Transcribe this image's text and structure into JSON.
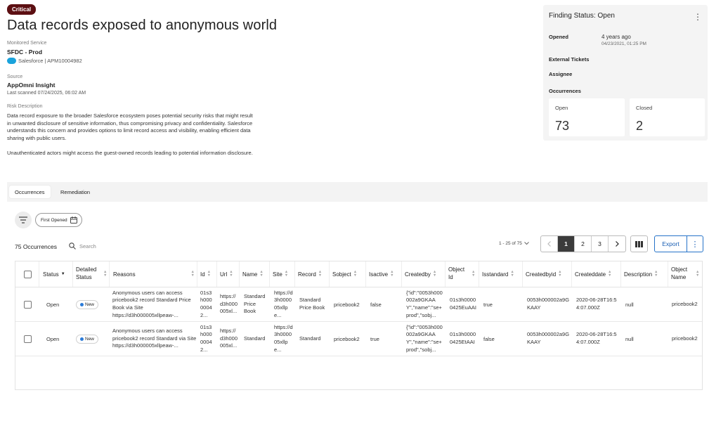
{
  "header": {
    "severity": "Critical",
    "title": "Data records exposed to anonymous world",
    "monitored_service_label": "Monitored Service",
    "monitored_service": "SFDC - Prod",
    "platform": "Salesforce | APM10004982",
    "source_label": "Source",
    "source": "AppOmni Insight",
    "last_scanned": "Last scanned 07/24/2025, 06:02 AM",
    "risk_label": "Risk Description",
    "risk_para1": "Data record exposure to the broader Salesforce ecosystem poses potential security risks that might result in unwanted disclosure of sensitive information, thus compromising privacy and confidentiality. Salesforce understands this concern and provides options to limit record access and visibility, enabling efficient data sharing with public users.",
    "risk_para2": "Unauthenticated actors might access the guest-owned records leading to potential information disclosure."
  },
  "status_panel": {
    "title": "Finding Status: Open",
    "opened_label": "Opened",
    "opened_rel": "4 years ago",
    "opened_abs": "04/23/2021, 01:25 PM",
    "external_tickets_label": "External Tickets",
    "assignee_label": "Assignee",
    "occurrences_label": "Occurrences",
    "open_label": "Open",
    "open_count": "73",
    "closed_label": "Closed",
    "closed_count": "2"
  },
  "tabs": [
    "Occurrences",
    "Remediation"
  ],
  "filters": {
    "chip_label": "First Opened"
  },
  "toolbar": {
    "count_label": "75 Occurrences",
    "search_placeholder": "Search",
    "range_label": "1 - 25 of 75",
    "pages": [
      "1",
      "2",
      "3"
    ],
    "export_label": "Export"
  },
  "table": {
    "columns": [
      "Status",
      "Detailed Status",
      "Reasons",
      "Id",
      "Url",
      "Name",
      "Site",
      "Record",
      "Sobject",
      "Isactive",
      "Createdby",
      "Object Id",
      "Isstandard",
      "Createdbyid",
      "Createddate",
      "Description",
      "Object Name"
    ],
    "rows": [
      {
        "status": "Open",
        "detailed": "New",
        "reasons": "Anonymous users can access pricebook2 record Standard Price Book via Site https://d3h000005xllpeaw-...",
        "id": "01s3h00000042...",
        "url": "https://d3h000005xl...",
        "name": "Standard Price Book",
        "site": "https://d3h000005xllpe...",
        "record": "Standard Price Book",
        "sobject": "pricebook2",
        "isactive": "false",
        "createdby": "{\"id\":\"0053h000002a9GKAAY\",\"name\":\"se+prod\",\"sobj...",
        "objectid": "01s3h00000425EuAAI",
        "isstandard": "true",
        "createdbyid": "0053h000002a9GKAAY",
        "createddate": "2020-06-28T16:54:07.000Z",
        "description": "null",
        "objectname": "pricebook2"
      },
      {
        "status": "Open",
        "detailed": "New",
        "reasons": "Anonymous users can access pricebook2 record Standard via Site https://d3h000005xllpeaw-...",
        "id": "01s3h00000042...",
        "url": "https://d3h000005xl...",
        "name": "Standard",
        "site": "https://d3h000005xllpe...",
        "record": "Standard",
        "sobject": "pricebook2",
        "isactive": "true",
        "createdby": "{\"id\":\"0053h000002a9GKAAY\",\"name\":\"se+prod\",\"sobj...",
        "objectid": "01s3h00000425EtAAI",
        "isstandard": "false",
        "createdbyid": "0053h000002a9GKAAY",
        "createddate": "2020-06-28T16:54:07.000Z",
        "description": "null",
        "objectname": "pricebook2"
      }
    ]
  },
  "colors": {
    "critical": "#5c0f12",
    "accent": "#2673c9",
    "status_dot": "#2b7bd8"
  }
}
